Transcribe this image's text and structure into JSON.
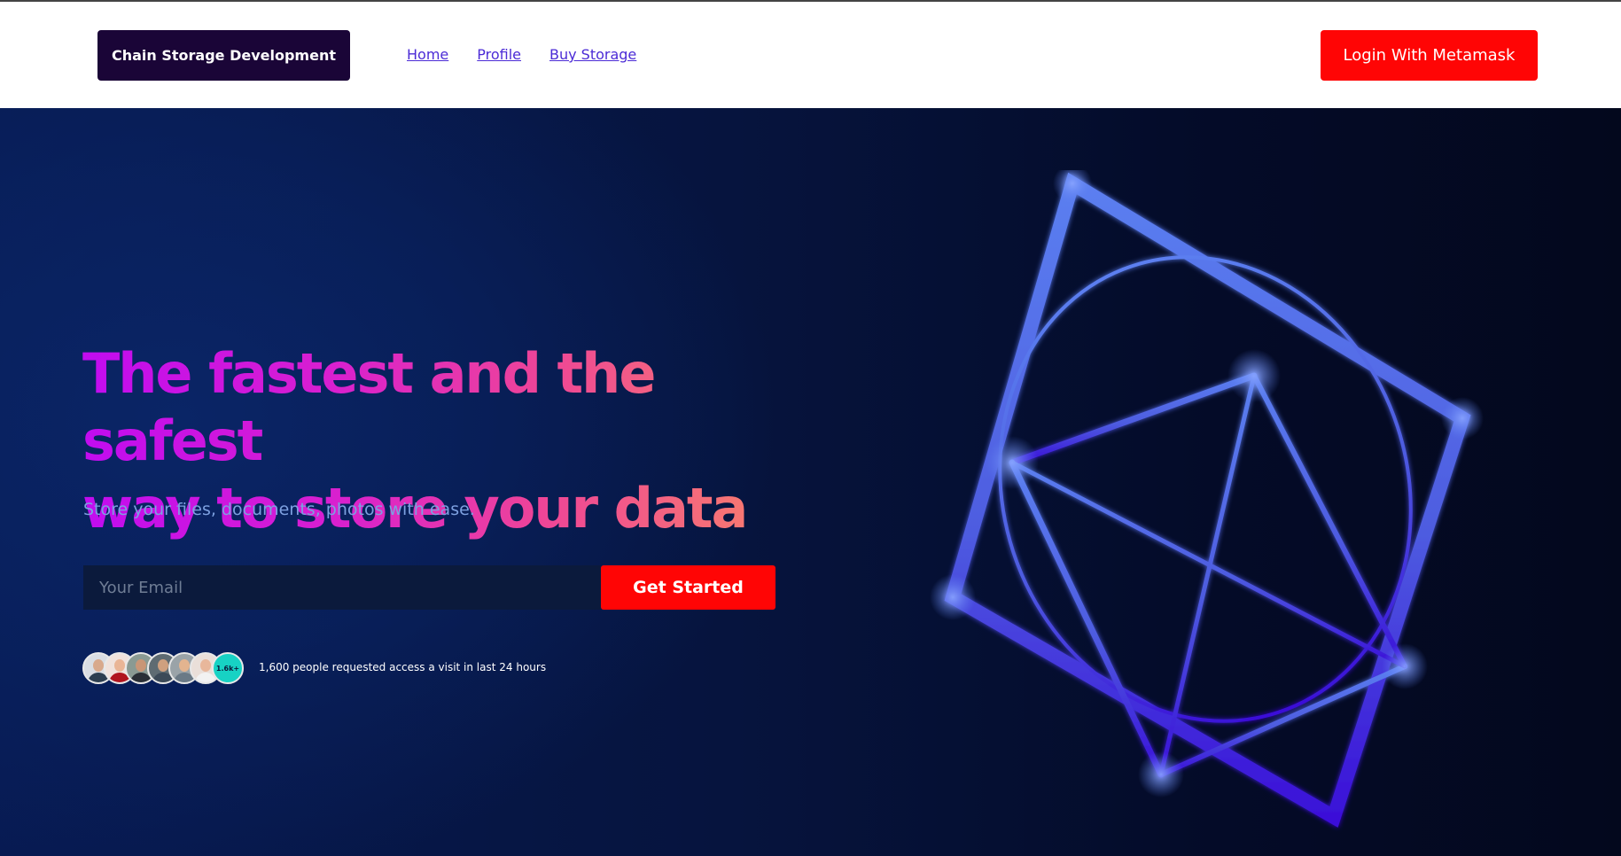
{
  "header": {
    "brand": "Chain Storage Development",
    "nav": [
      "Home",
      "Profile",
      "Buy Storage"
    ],
    "login_label": "Login With Metamask"
  },
  "hero": {
    "headline_line1": "The fastest and the safest",
    "headline_line2": "way to store your data",
    "subheadline": "Store your files, documents, photos with ease.",
    "email_placeholder": "Your Email",
    "cta_label": "Get Started",
    "avatar_count_badge": "1.6k+",
    "social_proof": "1,600 people requested access a visit in last 24 hours"
  },
  "colors": {
    "brand_bg": "#1a0537",
    "accent_red": "#ff0505",
    "link": "#4b2bd6",
    "hero_bg": "#071a52",
    "badge": "#17d2c4"
  }
}
